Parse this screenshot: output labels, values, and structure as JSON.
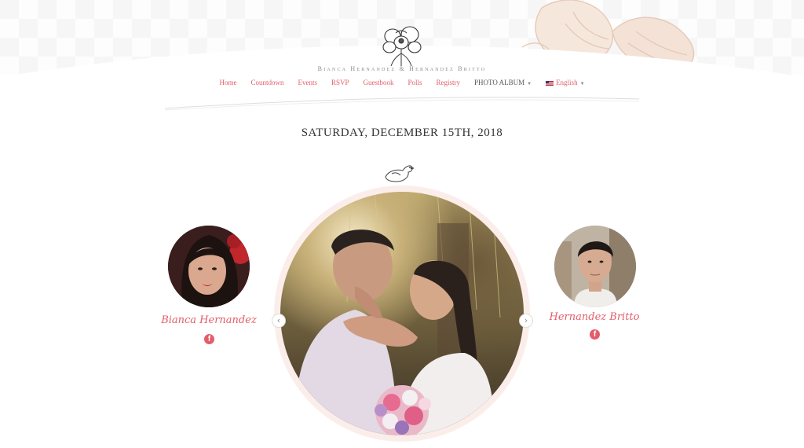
{
  "header": {
    "couple_title": "Bianca Hernandez & Hernandez Britto"
  },
  "nav": {
    "items": [
      {
        "label": "Home"
      },
      {
        "label": "Countdown"
      },
      {
        "label": "Events"
      },
      {
        "label": "RSVP"
      },
      {
        "label": "Guestbook"
      },
      {
        "label": "Polls"
      },
      {
        "label": "Registry"
      },
      {
        "label": "PHOTO ALBUM"
      },
      {
        "label": "English"
      }
    ]
  },
  "event": {
    "date": "SATURDAY, DECEMBER 15TH, 2018"
  },
  "people": {
    "bride": {
      "name": "Bianca Hernandez"
    },
    "groom": {
      "name": "Hernandez Britto"
    }
  },
  "carousel": {
    "prev_glyph": "‹",
    "next_glyph": "›"
  },
  "social": {
    "facebook_glyph": "f"
  },
  "colors": {
    "accent": "#e35d6a",
    "text_dark": "#333333",
    "ring": "#fbeeea"
  },
  "icons": [
    "orchid-logo-icon",
    "bird-icon",
    "facebook-icon",
    "chevron-left-icon",
    "chevron-right-icon",
    "flag-us-icon",
    "caret-down-icon"
  ]
}
